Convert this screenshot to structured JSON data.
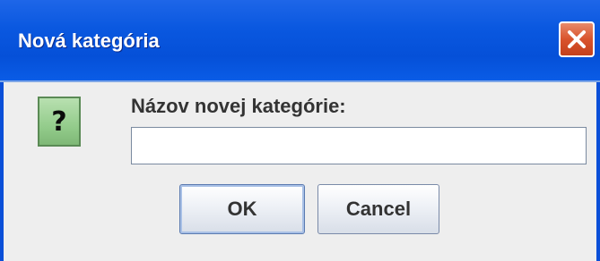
{
  "window": {
    "title": "Nová kategória"
  },
  "dialog": {
    "icon": "question-icon",
    "icon_glyph": "?",
    "prompt_label": "Názov novej kategórie:",
    "input_value": "",
    "input_placeholder": ""
  },
  "buttons": {
    "ok_label": "OK",
    "cancel_label": "Cancel"
  },
  "colors": {
    "titlebar": "#0a58e0",
    "close_button": "#d9532c",
    "icon_background": "#94cc8c"
  }
}
